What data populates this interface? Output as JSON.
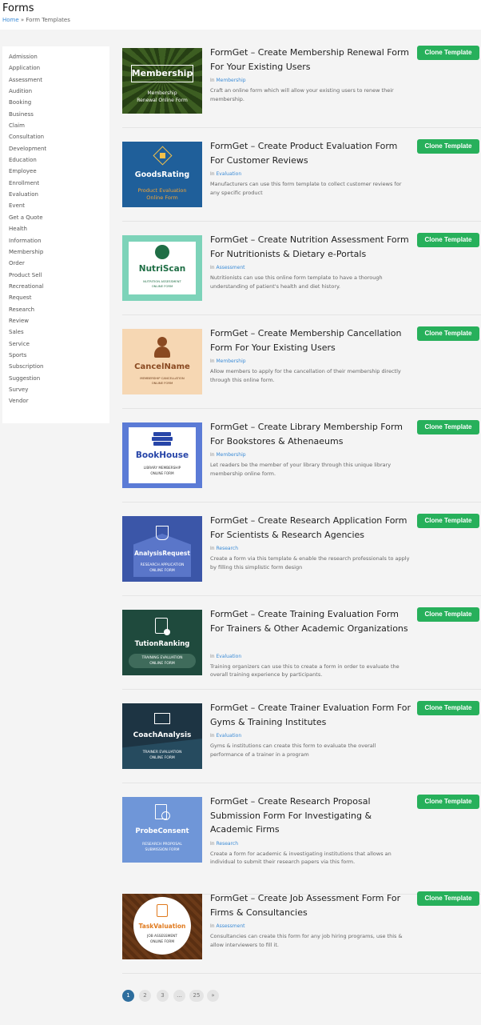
{
  "header": {
    "title": "Forms",
    "breadcrumb_home": "Home",
    "breadcrumb_sep": " » ",
    "breadcrumb_current": "Form Templates"
  },
  "sidebar": {
    "items": [
      "Admission",
      "Application",
      "Assessment",
      "Audition",
      "Booking",
      "Business",
      "Claim",
      "Consultation",
      "Development",
      "Education",
      "Employee",
      "Enrollment",
      "Evaluation",
      "Event",
      "Get a Quote",
      "Health",
      "Information",
      "Membership",
      "Order",
      "Product Sell",
      "Recreational",
      "Request",
      "Research",
      "Review",
      "Sales",
      "Service",
      "Sports",
      "Subscription",
      "Suggestion",
      "Survey",
      "Vendor"
    ]
  },
  "clone_label": "Clone Template",
  "in_label": "In",
  "templates": [
    {
      "title": "FormGet – Create Membership Renewal Form For Your Existing Users",
      "category": "Membership",
      "desc": "Craft an online form which will allow your existing users to renew their membership.",
      "thumb_name": "Membership",
      "thumb_sub": "Membership Renewal Online Form",
      "bg": "#2f4a1c"
    },
    {
      "title": "FormGet – Create Product Evaluation Form For Customer Reviews",
      "category": "Evaluation",
      "desc": "Manufacturers can use this form template to collect customer reviews for any specific product",
      "thumb_name": "GoodsRating",
      "thumb_sub": "Product Evaluation Online Form",
      "bg": "#1f5f9a"
    },
    {
      "title": "FormGet – Create Nutrition Assessment Form For Nutritionists & Dietary e-Portals",
      "category": "Assessment",
      "desc": "Nutritionists can use this online form template to have a thorough understanding of patient's health and diet history.",
      "thumb_name": "NutriScan",
      "thumb_sub": "NUTRITION ASSESSMENT ONLINE FORM",
      "bg": "#7dd3b9"
    },
    {
      "title": "FormGet – Create Membership Cancellation Form For Your Existing Users",
      "category": "Membership",
      "desc": "Allow members to apply for the cancellation of their membership directly through this online form.",
      "thumb_name": "CancelName",
      "thumb_sub": "MEMBERSHIP CANCELLATION ONLINE FORM",
      "bg": "#f6d7b3"
    },
    {
      "title": "FormGet – Create Library Membership Form For Bookstores & Athenaeums",
      "category": "Membership",
      "desc": "Let readers be the member of your library through this unique library membership online form.",
      "thumb_name": "BookHouse",
      "thumb_sub": "LIBRARY MEMBERSHIP ONLINE FORM",
      "bg": "#5b7bd6"
    },
    {
      "title": "FormGet – Create Research Application Form For Scientists & Research Agencies",
      "category": "Research",
      "desc": "Create a form via this template & enable the research professionals to apply by filling this simplistic form design",
      "thumb_name": "AnalysisRequest",
      "thumb_sub": "RESEARCH APPLICATION ONLINE FORM",
      "bg": "#3b56a8"
    },
    {
      "title": "FormGet – Create Training Evaluation Form For Trainers & Other Academic Organizations",
      "category": "Evaluation",
      "desc": "Training organizers can use this to create a form in order to evaluate the overall training experience by participants.",
      "thumb_name": "TutionRanking",
      "thumb_sub": "TRAINING EVALUATION ONLINE FORM",
      "bg": "#1f4a3d"
    },
    {
      "title": "FormGet – Create Trainer Evaluation Form For Gyms & Training Institutes",
      "category": "Evaluation",
      "desc": "Gyms & institutions can create this form to evaluate the overall performance of a trainer in a program",
      "thumb_name": "CoachAnalysis",
      "thumb_sub": "TRAINER EVALUATION ONLINE FORM",
      "bg": "#1d3443"
    },
    {
      "title": "FormGet – Create Research Proposal Submission Form For Investigating & Academic Firms",
      "category": "Research",
      "desc": "Create a form for academic & investigating institutions that allows an individual to submit their research papers via this form.",
      "thumb_name": "ProbeConsent",
      "thumb_sub": "RESEARCH PROPOSAL SUBMISSION FORM",
      "bg": "#6f96d8"
    },
    {
      "title": "FormGet – Create Job Assessment Form For Firms & Consultancies",
      "category": "Assessment",
      "desc": "Consultancies can create this form for any job hiring programs, use this & allow interviewers to fill it.",
      "thumb_name": "TaskValuation",
      "thumb_sub": "JOB ASSESSMENT ONLINE FORM",
      "bg": "#6b3a18"
    }
  ],
  "pagination": [
    "1",
    "2",
    "3",
    "...",
    "25",
    "»"
  ]
}
